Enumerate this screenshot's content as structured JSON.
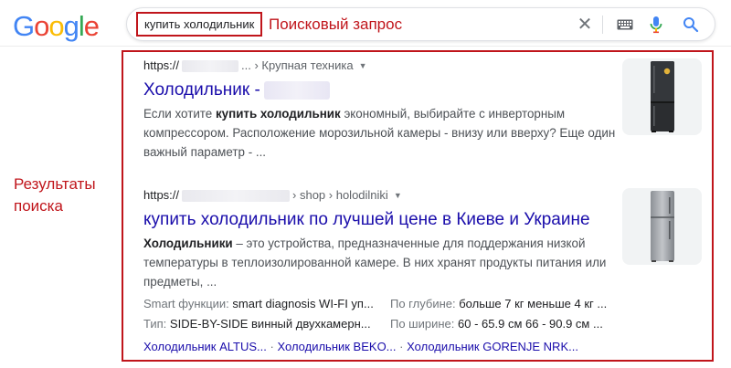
{
  "logo": {
    "letters": [
      "G",
      "o",
      "o",
      "g",
      "l",
      "e"
    ],
    "colors": [
      "#4285f4",
      "#ea4335",
      "#fbbc05",
      "#4285f4",
      "#34a853",
      "#ea4335"
    ]
  },
  "search": {
    "query": "купить холодильник"
  },
  "annotations": {
    "query_label": "Поисковый запрос",
    "results_label": "Результаты поиска",
    "color": "#c0151b"
  },
  "icons": {
    "clear": "close-icon",
    "keyboard": "keyboard-icon",
    "mic": "microphone-icon",
    "search": "search-icon"
  },
  "results": [
    {
      "url_prefix": "https://",
      "crumb": "... › Крупная техника",
      "title": "Холодильник -",
      "snippet_parts": [
        "Если хотите ",
        "купить холодильник",
        " экономный, выбирайте с инверторным компрессором. Расположение морозильной камеры - внизу или вверху? Еще один важный параметр - ..."
      ],
      "thumb": "black-fridge-image"
    },
    {
      "url_prefix": "https://",
      "crumb": "› shop › holodilniki",
      "title": "купить холодильник по лучшей цене в Киеве и Украине",
      "snippet_parts": [
        "Холодильники",
        " – это устройства, предназначенные для поддержания низкой температуры в теплоизолированной камере. В них хранят продукты питания или предметы, ..."
      ],
      "thumb": "silver-fridge-image",
      "attributes": [
        {
          "label": "Smart функции:",
          "value": "smart diagnosis WI-FI уп..."
        },
        {
          "label": "По глубине:",
          "value": "больше 7 кг меньше 4 кг ..."
        },
        {
          "label": "Тип:",
          "value": "SIDE-BY-SIDE винный двухкамерн..."
        },
        {
          "label": "По ширине:",
          "value": "60 - 65.9 см 66 - 90.9 см ..."
        }
      ],
      "sitelinks": [
        "Холодильник ALTUS...",
        "Холодильник BEKO...",
        "Холодильник GORENJE NRK..."
      ],
      "sitelink_separator": "·"
    }
  ]
}
